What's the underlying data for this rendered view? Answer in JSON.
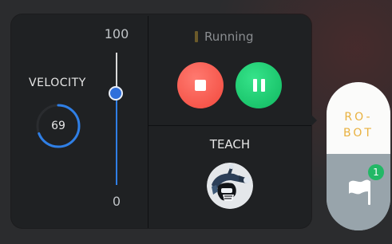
{
  "velocity": {
    "label": "VELOCITY",
    "value": "69",
    "gauge_fraction": 0.69
  },
  "slider": {
    "max_label": "100",
    "min_label": "0",
    "value": 69,
    "min": 0,
    "max": 100
  },
  "status": {
    "text": "Running"
  },
  "controls": {
    "stop_icon": "stop-icon",
    "pause_icon": "pause-icon"
  },
  "teach": {
    "label": "TEACH",
    "avatar_icon": "teach-robot-avatar"
  },
  "robot": {
    "label": "RO-\nBOT",
    "icon": "flag-icon",
    "badge_count": "1"
  },
  "colors": {
    "accent_blue": "#2f7fe6",
    "stop_red": "#f2483c",
    "pause_green": "#10b960",
    "robot_label": "#e9b13f",
    "badge_green": "#22b866",
    "status_amber": "#6b5a2a"
  }
}
